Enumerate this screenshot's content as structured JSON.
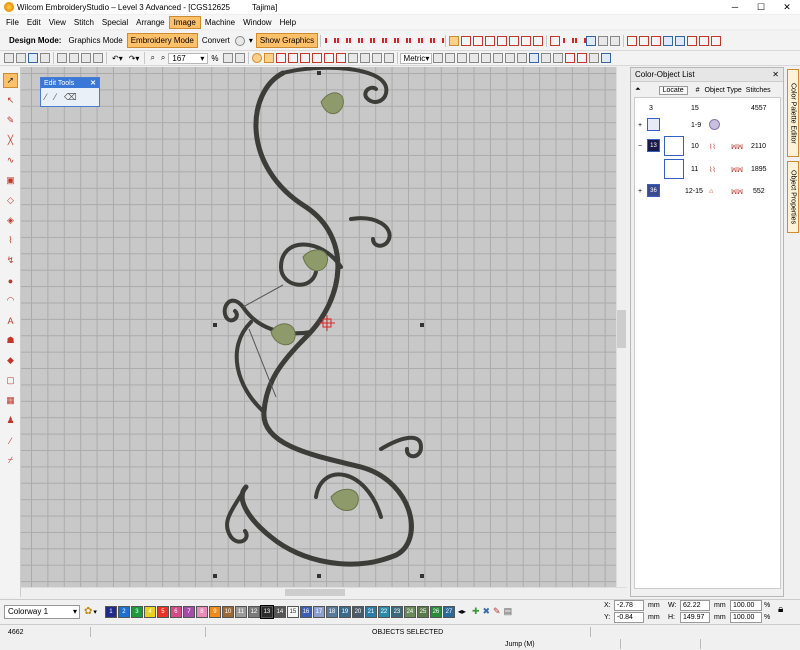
{
  "window": {
    "title": "Wilcom EmbroideryStudio – Level 3 Advanced - [CGS12625",
    "title_suffix": "Tajima]",
    "buttons": [
      "─",
      "☐",
      "✕"
    ]
  },
  "menu": {
    "items": [
      "File",
      "Edit",
      "View",
      "Stitch",
      "Special",
      "Arrange",
      "Image",
      "Machine",
      "Window",
      "Help"
    ],
    "active": "Image"
  },
  "toolbar1": {
    "design_mode_label": "Design Mode:",
    "graphics_mode": "Graphics Mode",
    "embroidery_mode": "Embroidery Mode",
    "convert": "Convert",
    "show_graphics": "Show Graphics"
  },
  "toolbar2": {
    "zoom_value": "167",
    "zoom_unit": "%",
    "units_value": "Metric"
  },
  "edit_tools": {
    "title": "Edit Tools",
    "close": "✕"
  },
  "color_object_list": {
    "title": "Color-Object List",
    "close": "✕",
    "locate_button": "Locate",
    "headers": {
      "num": "#",
      "object_type": "Object Type",
      "stitches": "Stitches"
    },
    "summary": {
      "colors": "3",
      "objects": "15",
      "stitches": "4557"
    },
    "rows": [
      {
        "index": "1-9",
        "stitches": ""
      },
      {
        "color": "13",
        "index": "10",
        "stitches": "2110"
      },
      {
        "index": "11",
        "stitches": "1895"
      },
      {
        "color": "36",
        "index": "12-15",
        "stitches": "552"
      }
    ],
    "expanders": [
      "+",
      "−",
      "+"
    ]
  },
  "side_tabs": {
    "color_palette_editor": "Color Palette Editor",
    "object_properties": "Object Properties"
  },
  "bottom": {
    "colorway": "Colorway 1",
    "chips": [
      {
        "n": "1",
        "c": "#1f2a8a"
      },
      {
        "n": "2",
        "c": "#1d6fd0"
      },
      {
        "n": "3",
        "c": "#1a9a3a"
      },
      {
        "n": "4",
        "c": "#e8d21a"
      },
      {
        "n": "5",
        "c": "#e8332a"
      },
      {
        "n": "6",
        "c": "#d64a86"
      },
      {
        "n": "7",
        "c": "#a44da8"
      },
      {
        "n": "8",
        "c": "#e88bb6"
      },
      {
        "n": "9",
        "c": "#f08a1a"
      },
      {
        "n": "10",
        "c": "#9b6a3a"
      },
      {
        "n": "11",
        "c": "#9a9a9a"
      },
      {
        "n": "12",
        "c": "#7a7a7a"
      },
      {
        "n": "13",
        "c": "#2a2a2a"
      },
      {
        "n": "14",
        "c": "#555555"
      },
      {
        "n": "15",
        "c": "#f5f5f5"
      },
      {
        "n": "16",
        "c": "#3a5db5"
      },
      {
        "n": "17",
        "c": "#8aa0d0"
      },
      {
        "n": "18",
        "c": "#5a7a9a"
      },
      {
        "n": "19",
        "c": "#3a6a8a"
      },
      {
        "n": "20",
        "c": "#4a5a6a"
      },
      {
        "n": "21",
        "c": "#2a7aaa"
      },
      {
        "n": "22",
        "c": "#2a8aaa"
      },
      {
        "n": "23",
        "c": "#3a6a7a"
      },
      {
        "n": "24",
        "c": "#6a8a5a"
      },
      {
        "n": "25",
        "c": "#5a7a4a"
      },
      {
        "n": "26",
        "c": "#2a8a3a"
      },
      {
        "n": "27",
        "c": "#2a6a9a"
      }
    ],
    "x_label": "X:",
    "x_value": "-2.78",
    "x_unit": "mm",
    "y_label": "Y:",
    "y_value": "-0.84",
    "y_unit": "mm",
    "w_label": "W:",
    "w_value": "62.22",
    "w_unit": "mm",
    "h_label": "H:",
    "h_value": "149.97",
    "h_unit": "mm",
    "w_pct": "100.00",
    "h_pct": "100.00",
    "pct": "%"
  },
  "status": {
    "stitch_count": "4662",
    "selection": "OBJECTS SELECTED",
    "mode": "Jump (M)"
  },
  "colors": {
    "accent": "#ffc06a",
    "canvas": "#c8c8c8",
    "thread": "#3c3c38",
    "leaf": "#8e9a6a"
  }
}
